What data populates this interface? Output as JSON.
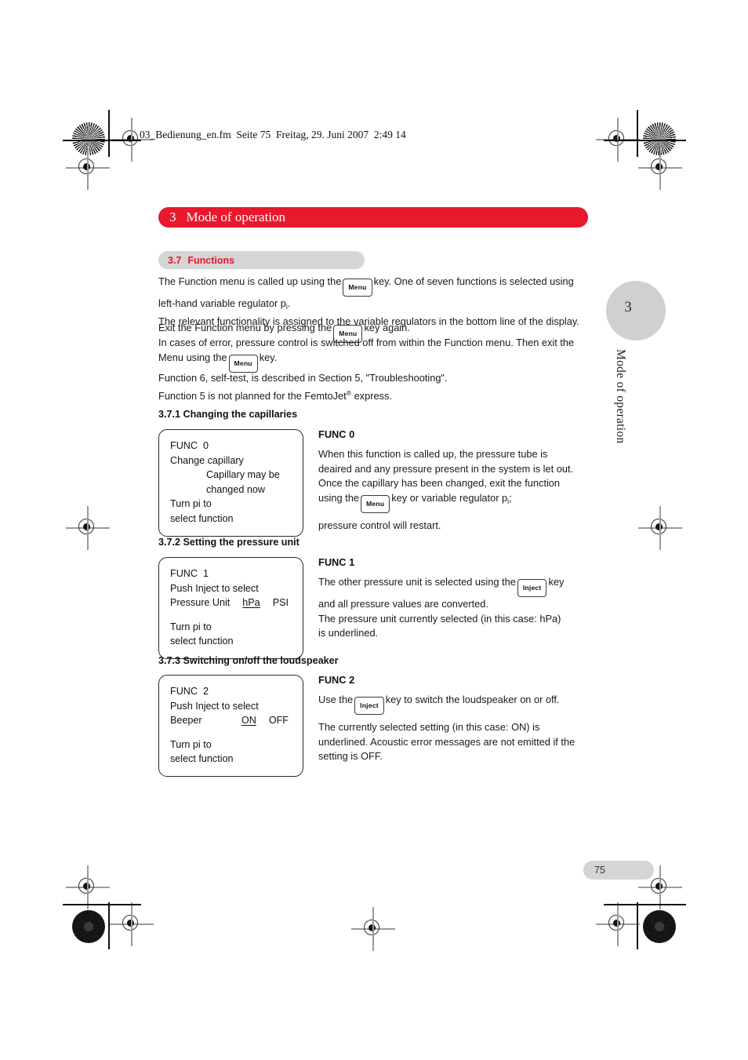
{
  "document": {
    "file_strip": "03_Bedienung_en.fm  Seite 75  Freitag, 29. Juni 2007  2:49 14",
    "page_number": "75"
  },
  "chapter": {
    "number": "3",
    "title": "Mode of operation",
    "tab_number": "3",
    "side_label": "Mode of operation",
    "banner_color": "#e8192c"
  },
  "section": {
    "number": "3.7",
    "title": "Functions",
    "bar_color": "#d5d5d5",
    "text_color": "#e8192c"
  },
  "intro": {
    "p1_line1_a": "The Function menu is called up using the",
    "p1_key": "Menu",
    "p1_line1_b": "key. One of seven functions is selected using",
    "p1_line2_a": "left-hand variable regulator p",
    "p1_line2_sub": "i",
    "p1_line2_b": ".",
    "p1_line3": "The relevant functionality is assigned to the variable regulators in the bottom line of the display.",
    "p2_a": "Exit the Function menu by pressing the",
    "p2_key": "Menu",
    "p2_b": "key again.",
    "p3_line1": "In cases of error, pressure control is switched off from within the Function menu. Then exit the",
    "p3_line2_a": "Menu using the",
    "p3_key": "Menu",
    "p3_line2_b": "key.",
    "p4_line1": "Function 6, self-test, is described in Section 5, \"Troubleshooting\".",
    "p4_line2_a": "Function 5 is not planned for the FemtoJet",
    "p4_line2_sup": "®",
    "p4_line2_b": "express."
  },
  "subsections": [
    {
      "heading": "3.7.1  Changing the capillaries",
      "lcd": {
        "line1": "FUNC  0",
        "line2": "Change capillary",
        "line3": "Capillary may be",
        "line4": "changed now",
        "line5": "Turn pi to",
        "line6": "select function"
      },
      "func_title": "FUNC 0",
      "body_line1": "When this function is called up, the pressure tube is",
      "body_line2": "deaired and any pressure present in the system is let out.",
      "body_line3": "Once the capillary has been changed, exit the function",
      "body_line4_a": "using the",
      "body_key": "Menu",
      "body_line4_b": "key or variable regulator p",
      "body_line4_sub": "i",
      "body_line4_c": ";",
      "body_line5": "pressure control will restart."
    },
    {
      "heading": "3.7.2  Setting the pressure unit",
      "lcd": {
        "line1": "FUNC  1",
        "line2": "Push Inject to select",
        "option_label": "Pressure Unit",
        "option_selected": "hPa",
        "option_other": "PSI",
        "line5": "Turn pi to",
        "line6": "select function"
      },
      "func_title": "FUNC 1",
      "body_line1_a": "The other pressure unit is selected using the",
      "body_key": "Inject",
      "body_line1_b": "key",
      "body_line2": "and all pressure values are converted.",
      "body_line3": "The pressure unit currently selected (in this case: hPa)",
      "body_line4": "is underlined."
    },
    {
      "heading": "3.7.3 Switching on/off the loudspeaker",
      "lcd": {
        "line1": "FUNC  2",
        "line2": "Push Inject to select",
        "option_label": "Beeper",
        "option_selected": "ON",
        "option_other": "OFF",
        "line5": "Turn pi to",
        "line6": "select function"
      },
      "func_title": "FUNC 2",
      "body_line1_a": "Use the",
      "body_key": "Inject",
      "body_line1_b": "key to switch the loudspeaker on or off.",
      "body_line2": "The currently selected setting (in this case: ON) is",
      "body_line3": "underlined. Acoustic error messages are not emitted if the",
      "body_line4": "setting is OFF."
    }
  ]
}
